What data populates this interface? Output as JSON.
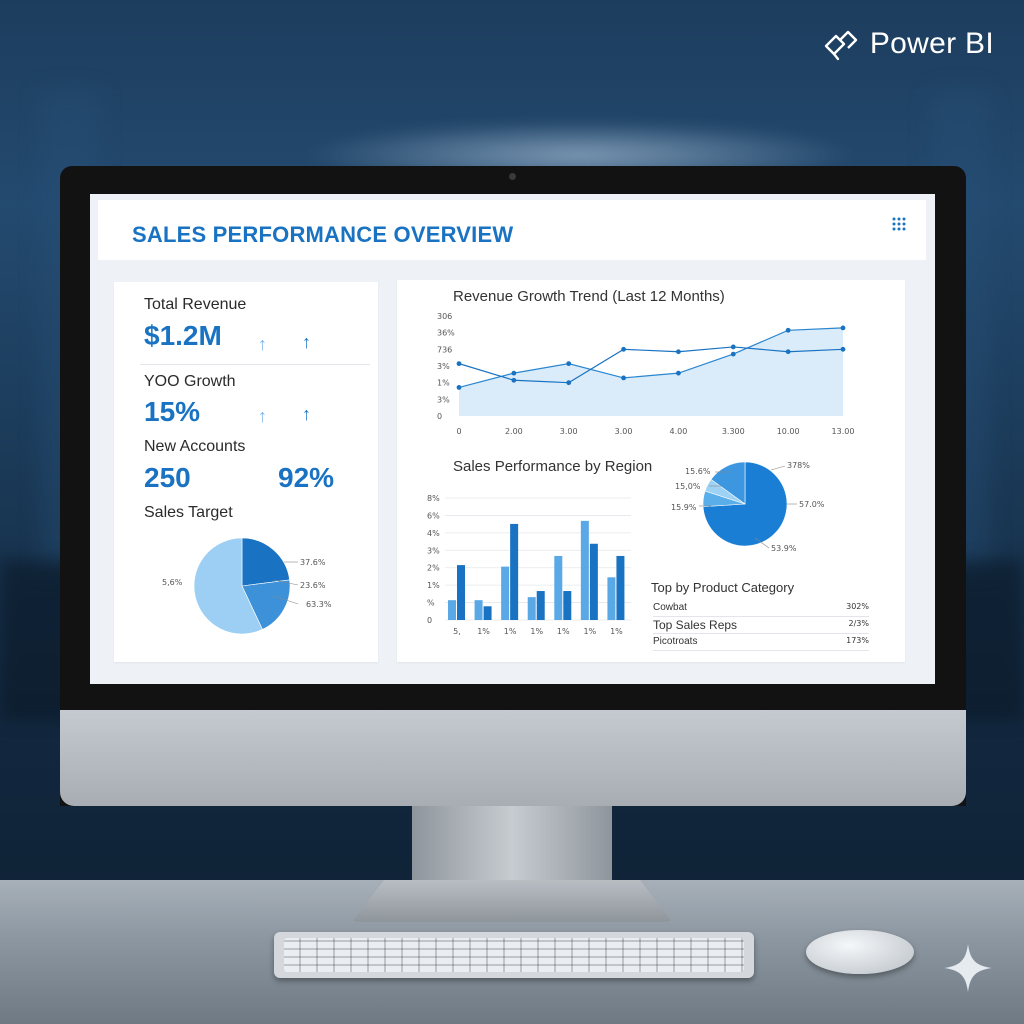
{
  "brand": {
    "name": "Power BI"
  },
  "dashboard": {
    "title": "SALES PERFORMANCE OVERVIEW",
    "kpis": [
      {
        "label": "Total Revenue",
        "value": "$1.2M",
        "arrows": [
          "↑",
          "↑"
        ]
      },
      {
        "label": "YOO Growth",
        "value": "15%",
        "arrows": [
          "↑",
          "↑"
        ]
      },
      {
        "label": "New Accounts",
        "value": "250",
        "extra_value": "92%"
      }
    ],
    "sales_target": {
      "label": "Sales Target",
      "labels": {
        "left": "5,6%",
        "top": "37.6%",
        "mid": "23.6%",
        "bottom": "63.3%"
      }
    },
    "revenue_trend": {
      "title": "Revenue Growth Trend (Last 12 Months)",
      "y_ticks": [
        "306",
        "36%",
        "736",
        "3%",
        "1%",
        "3%",
        "0"
      ],
      "x_ticks": [
        "0",
        "2.00",
        "3.00",
        "3.00",
        "4.00",
        "3.300",
        "10.00",
        "13.00"
      ]
    },
    "region": {
      "title": "Sales Performance by Region",
      "y_ticks": [
        "8%",
        "6%",
        "4%",
        "3%",
        "2%",
        "1%",
        "%",
        "0"
      ],
      "x_ticks": [
        "5,",
        "1%",
        "1%",
        "1%",
        "1%",
        "1%",
        "1%"
      ]
    },
    "region_pie": {
      "labels": {
        "tl": "15.6%",
        "tr": "378%",
        "ml": "15,0%",
        "bl": "15.9%",
        "r": "57.0%",
        "b": "53.9%"
      }
    },
    "product_table": {
      "title": "Top by Product Category",
      "rows": [
        {
          "name": "Cowbat",
          "value": "302%"
        },
        {
          "name": "Top Sales Reps",
          "value": "2/3%"
        },
        {
          "name": "Picotroats",
          "value": "173%"
        }
      ]
    }
  },
  "chart_data": [
    {
      "type": "line",
      "title": "Revenue Growth Trend (Last 12 Months)",
      "x_tick_labels": [
        "0",
        "2.00",
        "3.00",
        "3.00",
        "4.00",
        "3.300",
        "10.00",
        "13.00"
      ],
      "y_tick_labels": [
        "306",
        "36%",
        "736",
        "3%",
        "1%",
        "3%",
        "0"
      ],
      "series": [
        {
          "values": [
            1.2,
            1.8,
            2.2,
            1.6,
            1.8,
            2.6,
            3.6,
            3.7
          ],
          "style": "area"
        },
        {
          "values": [
            2.2,
            1.5,
            1.4,
            2.8,
            2.7,
            2.9,
            2.7,
            2.8
          ],
          "style": "line"
        }
      ],
      "grid": false
    },
    {
      "type": "bar",
      "title": "Sales Performance by Region",
      "categories": [
        "5,",
        "1%",
        "1%",
        "1%",
        "1%",
        "1%",
        "1%"
      ],
      "y_tick_labels": [
        "8%",
        "6%",
        "4%",
        "3%",
        "2%",
        "1%",
        "%",
        "0"
      ],
      "series": [
        {
          "values": [
            1.3,
            1.3,
            3.5,
            1.5,
            4.2,
            6.5,
            2.8
          ],
          "color": "#5aa9e6"
        },
        {
          "values": [
            3.6,
            0.9,
            6.3,
            1.9,
            1.9,
            5.0,
            4.2
          ],
          "color": "#1a73c2"
        }
      ],
      "ylim": [
        0,
        8
      ],
      "grid": true
    },
    {
      "type": "pie",
      "labels": [
        "37.6%",
        "23.6%",
        "63.3%",
        "5,6%"
      ],
      "values": [
        23,
        20,
        57
      ],
      "colors": [
        "#1a73c2",
        "#3d91d8",
        "#9ccff3"
      ]
    },
    {
      "type": "pie",
      "labels": [
        "15.6%",
        "378%",
        "15,0%",
        "15.9%",
        "57.0%",
        "53.9%"
      ],
      "values": [
        74,
        6,
        5,
        15
      ],
      "colors": [
        "#1a7fd4",
        "#5aaee9",
        "#9ed2f5",
        "#3c97e0"
      ]
    }
  ]
}
